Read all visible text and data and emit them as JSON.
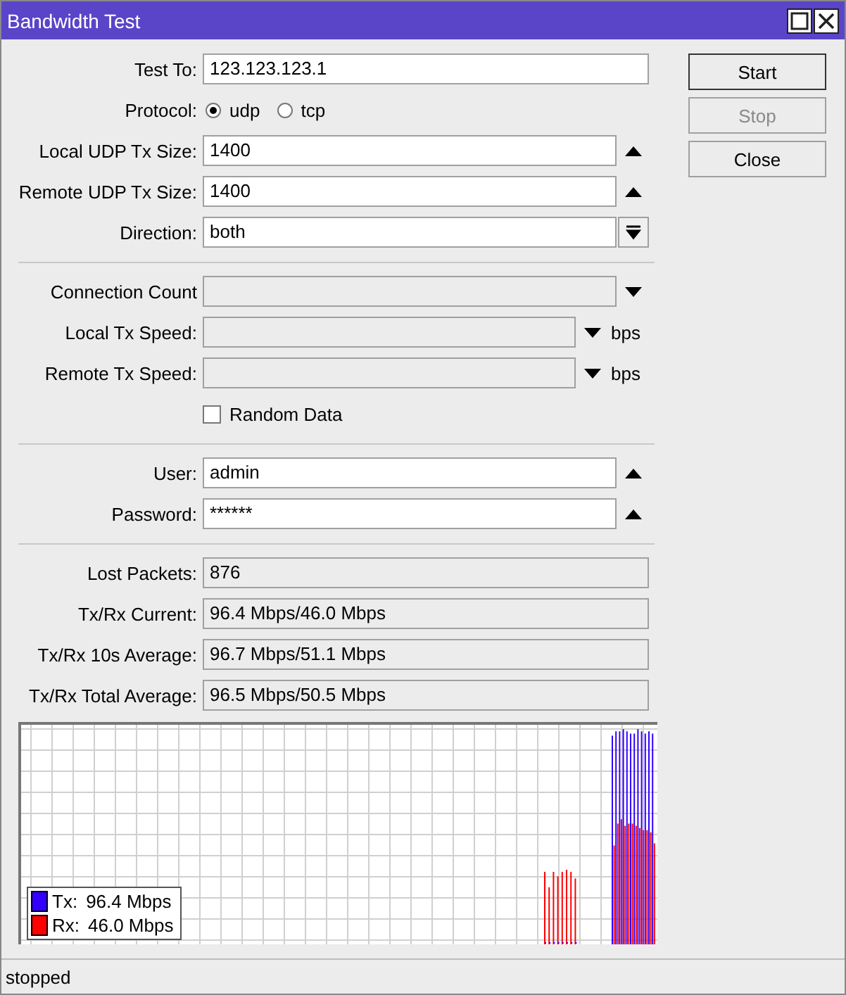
{
  "window": {
    "title": "Bandwidth Test"
  },
  "sections": [
    [
      {
        "kind": "text",
        "label": "Test To:",
        "value": "123.123.123.1"
      },
      {
        "kind": "radio",
        "label": "Protocol:",
        "options": [
          {
            "label": "udp",
            "selected": true
          },
          {
            "label": "tcp",
            "selected": false
          }
        ]
      },
      {
        "kind": "spin",
        "label": "Local UDP Tx Size:",
        "value": "1400"
      },
      {
        "kind": "spin",
        "label": "Remote UDP Tx Size:",
        "value": "1400"
      },
      {
        "kind": "select",
        "label": "Direction:",
        "value": "both"
      }
    ],
    [
      {
        "kind": "empty",
        "label": "Connection Count"
      },
      {
        "kind": "speed",
        "label": "Local Tx Speed:",
        "unit": "bps"
      },
      {
        "kind": "speed",
        "label": "Remote Tx Speed:",
        "unit": "bps"
      },
      {
        "kind": "checkbox",
        "label": "Random Data",
        "checked": false
      }
    ],
    [
      {
        "kind": "spin",
        "label": "User:",
        "value": "admin"
      },
      {
        "kind": "spin",
        "label": "Password:",
        "value": "******"
      }
    ],
    [
      {
        "kind": "readonly",
        "label": "Lost Packets:",
        "value": "876"
      },
      {
        "kind": "readonly",
        "label": "Tx/Rx Current:",
        "value": "96.4 Mbps/46.0 Mbps"
      },
      {
        "kind": "readonly",
        "label": "Tx/Rx 10s Average:",
        "value": "96.7 Mbps/51.1 Mbps"
      },
      {
        "kind": "readonly",
        "label": "Tx/Rx Total Average:",
        "value": "96.5 Mbps/50.5 Mbps"
      }
    ]
  ],
  "graph": {
    "legend": [
      {
        "label": "Tx:",
        "value": "96.4 Mbps",
        "color": "#3300ff"
      },
      {
        "label": "Rx:",
        "value": "46.0 Mbps",
        "color": "#ff0000"
      }
    ]
  },
  "buttons": [
    {
      "label": "Start",
      "default": true,
      "disabled": false
    },
    {
      "label": "Stop",
      "default": false,
      "disabled": true
    },
    {
      "label": "Close",
      "default": false,
      "disabled": false
    }
  ],
  "status_bar": "stopped"
}
